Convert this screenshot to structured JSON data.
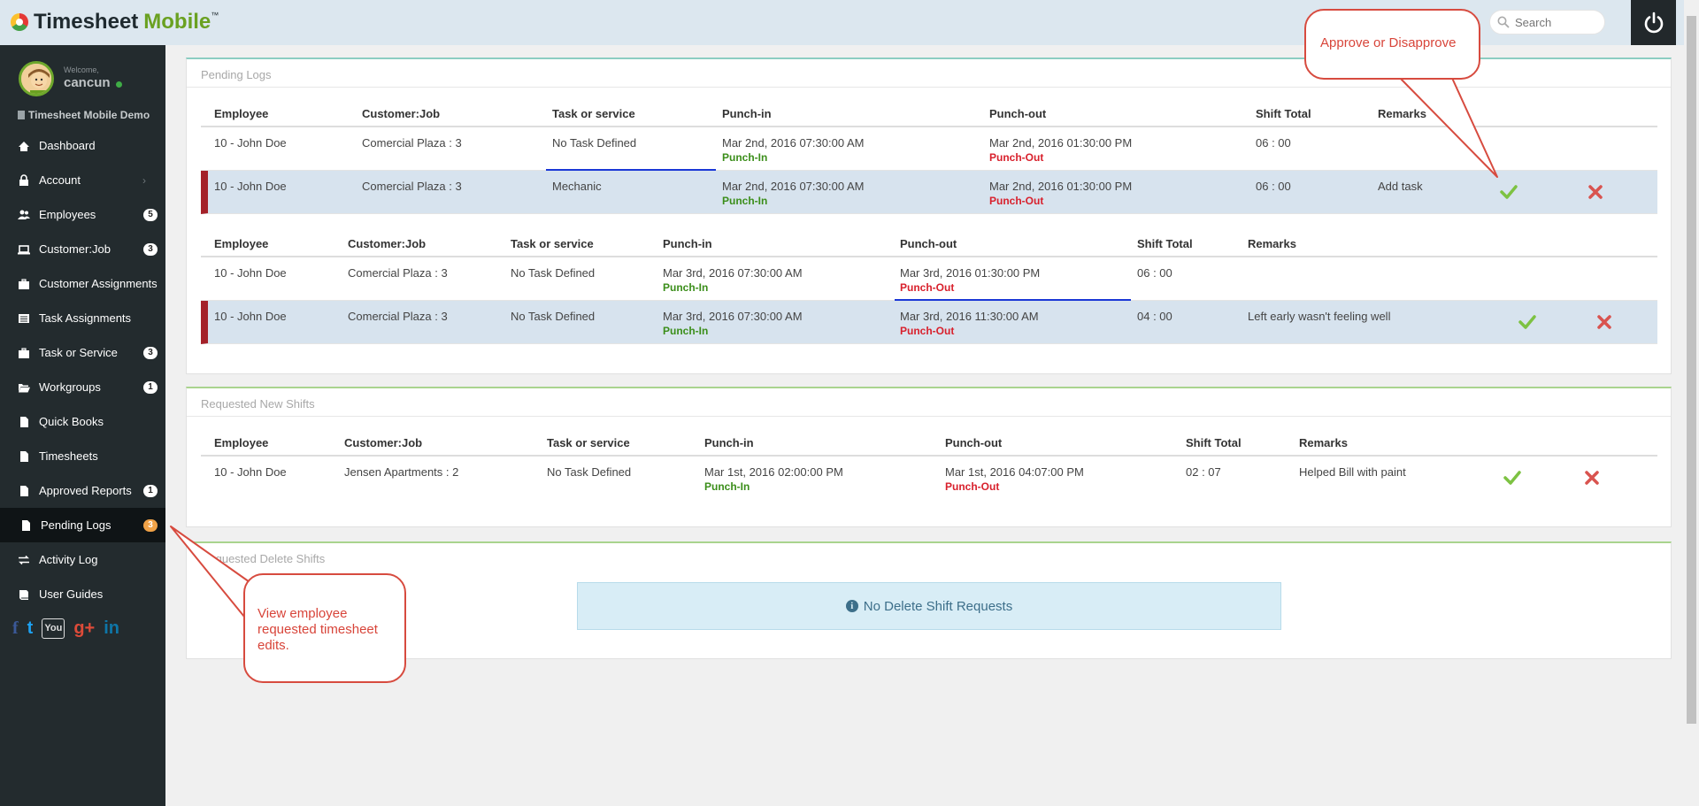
{
  "app": {
    "logo_part1": "Timesheet",
    "logo_part2": "Mobile",
    "logo_tm": "™",
    "search_placeholder": "Search"
  },
  "sidebar": {
    "welcome": "Welcome,",
    "username": "cancun",
    "company": "Timesheet Mobile Demo",
    "items": [
      {
        "label": "Dashboard",
        "icon": "dashboard-icon"
      },
      {
        "label": "Account",
        "icon": "lock-icon",
        "chevron": "›"
      },
      {
        "label": "Employees",
        "icon": "users-icon",
        "badge": "5"
      },
      {
        "label": "Customer:Job",
        "icon": "laptop-icon",
        "badge": "3"
      },
      {
        "label": "Customer Assignments",
        "icon": "briefcase-icon"
      },
      {
        "label": "Task Assignments",
        "icon": "list-icon"
      },
      {
        "label": "Task or Service",
        "icon": "briefcase-icon",
        "badge": "3"
      },
      {
        "label": "Workgroups",
        "icon": "folder-open-icon",
        "badge": "1"
      },
      {
        "label": "Quick Books",
        "icon": "file-icon"
      },
      {
        "label": "Timesheets",
        "icon": "file-icon"
      },
      {
        "label": "Approved Reports",
        "icon": "file-icon",
        "badge": "1"
      },
      {
        "label": "Pending Logs",
        "icon": "file-icon",
        "badge": "3"
      },
      {
        "label": "Activity Log",
        "icon": "exchange-icon"
      },
      {
        "label": "User Guides",
        "icon": "book-icon"
      }
    ],
    "social": [
      "f",
      "t",
      "You",
      "g+",
      "in"
    ]
  },
  "pending_logs": {
    "title": "Pending Logs",
    "group1": {
      "headers": [
        "Employee",
        "Customer:Job",
        "Task or service",
        "Punch-in",
        "Punch-out",
        "Shift Total",
        "Remarks"
      ],
      "rows": [
        {
          "employee": "10 - John Doe",
          "job": "Comercial Plaza : 3",
          "task": "No Task Defined",
          "punch_in": "Mar 2nd, 2016 07:30:00 AM",
          "punch_in_label": "Punch-In",
          "punch_out": "Mar 2nd, 2016 01:30:00 PM",
          "punch_out_label": "Punch-Out",
          "total": "06 : 00",
          "remarks": ""
        },
        {
          "employee": "10 - John Doe",
          "job": "Comercial Plaza : 3",
          "task": "Mechanic",
          "punch_in": "Mar 2nd, 2016 07:30:00 AM",
          "punch_in_label": "Punch-In",
          "punch_out": "Mar 2nd, 2016 01:30:00 PM",
          "punch_out_label": "Punch-Out",
          "total": "06 : 00",
          "remarks": "Add task"
        }
      ]
    },
    "group2": {
      "headers": [
        "Employee",
        "Customer:Job",
        "Task or service",
        "Punch-in",
        "Punch-out",
        "Shift Total",
        "Remarks"
      ],
      "rows": [
        {
          "employee": "10 - John Doe",
          "job": "Comercial Plaza : 3",
          "task": "No Task Defined",
          "punch_in": "Mar 3rd, 2016 07:30:00 AM",
          "punch_in_label": "Punch-In",
          "punch_out": "Mar 3rd, 2016 01:30:00 PM",
          "punch_out_label": "Punch-Out",
          "total": "06 : 00",
          "remarks": ""
        },
        {
          "employee": "10 - John Doe",
          "job": "Comercial Plaza : 3",
          "task": "No Task Defined",
          "punch_in": "Mar 3rd, 2016 07:30:00 AM",
          "punch_in_label": "Punch-In",
          "punch_out": "Mar 3rd, 2016 11:30:00 AM",
          "punch_out_label": "Punch-Out",
          "total": "04 : 00",
          "remarks": "Left early wasn't feeling well"
        }
      ]
    }
  },
  "requested_new_shifts": {
    "title": "Requested New Shifts",
    "headers": [
      "Employee",
      "Customer:Job",
      "Task or service",
      "Punch-in",
      "Punch-out",
      "Shift Total",
      "Remarks"
    ],
    "rows": [
      {
        "employee": "10 - John Doe",
        "job": "Jensen Apartments : 2",
        "task": "No Task Defined",
        "punch_in": "Mar 1st, 2016 02:00:00 PM",
        "punch_in_label": "Punch-In",
        "punch_out": "Mar 1st, 2016 04:07:00 PM",
        "punch_out_label": "Punch-Out",
        "total": "02 : 07",
        "remarks": "Helped Bill with paint"
      }
    ]
  },
  "requested_delete_shifts": {
    "title": "Requested Delete Shifts",
    "empty_message": "No Delete Shift Requests"
  },
  "callouts": {
    "approve": "Approve or Disapprove",
    "view": "View employee requested timesheet edits."
  },
  "colors": {
    "punch_in": "#3b8e1a",
    "punch_out": "#d8202c",
    "approve": "#7dc242",
    "reject": "#d9534f",
    "sidebar_bg": "#232b2e"
  }
}
